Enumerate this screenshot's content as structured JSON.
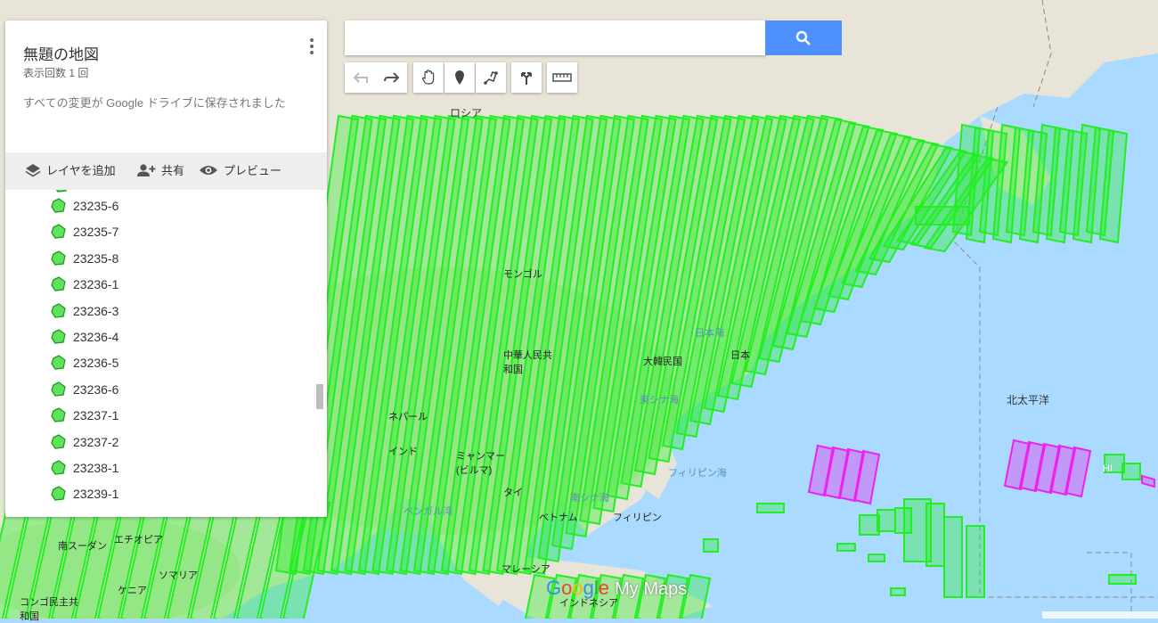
{
  "panel": {
    "title": "無題の地図",
    "views": "表示回数 1 回",
    "saved_status": "すべての変更が Google ドライブに保存されました",
    "actions": {
      "add_layer": "レイヤを追加",
      "share": "共有",
      "preview": "プレビュー"
    }
  },
  "layers": [
    "23235-6",
    "23235-7",
    "23235-8",
    "23236-1",
    "23236-3",
    "23236-4",
    "23236-5",
    "23236-6",
    "23237-1",
    "23237-2",
    "23238-1",
    "23239-1"
  ],
  "search": {
    "placeholder": ""
  },
  "map_labels": {
    "russia": "ロシア",
    "mongolia": "モンゴル",
    "china": "中華人民共和国",
    "nepal": "ネパール",
    "india": "インド",
    "myanmar": "ミャンマー(ビルマ)",
    "thailand": "タイ",
    "vietnam": "ベトナム",
    "philippines": "フィリピン",
    "korea": "大韓民国",
    "japan": "日本",
    "north_pacific": "北太平洋",
    "philippine_sea": "フィリピン海",
    "bay_of_bengal": "ベンガル湾",
    "south_china_sea": "南シナ海",
    "east_china_sea": "東シナ海",
    "sea_of_japan": "日本海",
    "malaysia": "マレーシア",
    "indonesia": "インドネシア",
    "south_sudan": "南スーダン",
    "ethiopia": "エチオピア",
    "somalia": "ソマリア",
    "kenya": "ケニア",
    "congo": "コンゴ民主共和国",
    "hi": "HI"
  },
  "logo": {
    "google": "Google",
    "my_maps": "My Maps"
  },
  "colors": {
    "footprint_green": "#22ee22",
    "footprint_pink": "#ee22ee",
    "search_blue": "#4d90fe",
    "ocean": "#aadaff",
    "land": "#e8e4d8"
  }
}
